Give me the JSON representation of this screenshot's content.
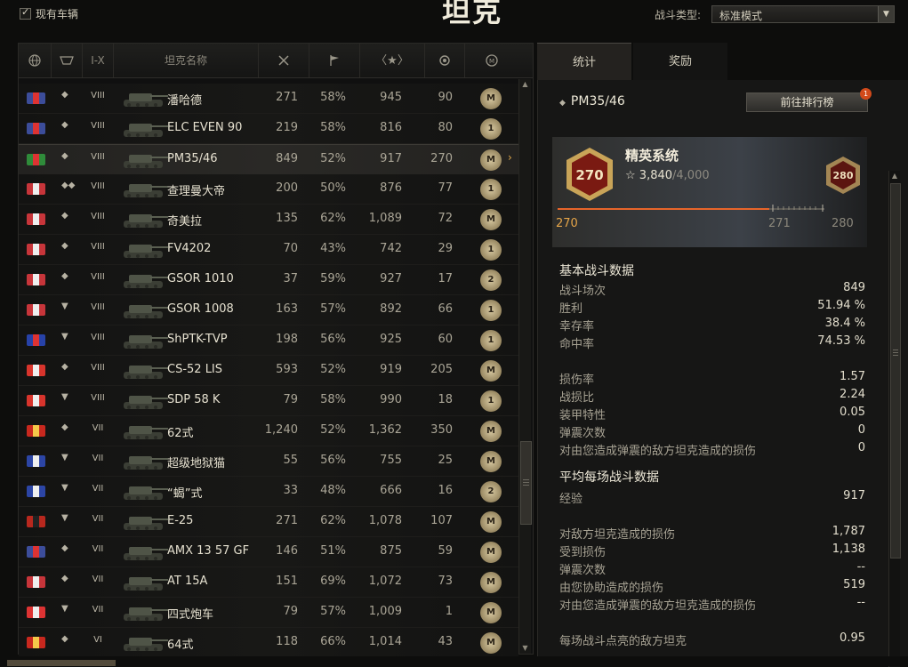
{
  "header": {
    "show_owned_label": "现有车辆",
    "title": "坦克",
    "battle_type_label": "战斗类型:",
    "battle_type_value": "标准模式"
  },
  "columns": {
    "tier": "I-X",
    "name": "坦克名称"
  },
  "tanks": [
    {
      "flag": "#3c4d9a",
      "flag2": "#d33",
      "type": "◆",
      "tier": "VIII",
      "name": "潘哈德",
      "battles": "271",
      "winrate": "58%",
      "xp": "945",
      "wn": "90",
      "badge": "M"
    },
    {
      "flag": "#3c4d9a",
      "flag2": "#d33",
      "type": "◆",
      "tier": "VIII",
      "name": "ELC EVEN 90",
      "battles": "219",
      "winrate": "58%",
      "xp": "816",
      "wn": "80",
      "badge": "1"
    },
    {
      "flag": "#2f8b3a",
      "flag2": "#d33",
      "type": "◆",
      "tier": "VIII",
      "name": "PM35/46",
      "battles": "849",
      "winrate": "52%",
      "xp": "917",
      "wn": "270",
      "badge": "M",
      "selected": true
    },
    {
      "flag": "#c7353a",
      "flag2": "#eee",
      "type": "◆◆",
      "tier": "VIII",
      "name": "查理曼大帝",
      "battles": "200",
      "winrate": "50%",
      "xp": "876",
      "wn": "77",
      "badge": "1"
    },
    {
      "flag": "#c7353a",
      "flag2": "#eee",
      "type": "◆",
      "tier": "VIII",
      "name": "奇美拉",
      "battles": "135",
      "winrate": "62%",
      "xp": "1,089",
      "wn": "72",
      "badge": "M"
    },
    {
      "flag": "#c7353a",
      "flag2": "#eee",
      "type": "◆",
      "tier": "VIII",
      "name": "FV4202",
      "battles": "70",
      "winrate": "43%",
      "xp": "742",
      "wn": "29",
      "badge": "1"
    },
    {
      "flag": "#c7353a",
      "flag2": "#eee",
      "type": "◆",
      "tier": "VIII",
      "name": "GSOR 1010",
      "battles": "37",
      "winrate": "59%",
      "xp": "927",
      "wn": "17",
      "badge": "2"
    },
    {
      "flag": "#c7353a",
      "flag2": "#eee",
      "type": "▼",
      "tier": "VIII",
      "name": "GSOR 1008",
      "battles": "163",
      "winrate": "57%",
      "xp": "892",
      "wn": "66",
      "badge": "1"
    },
    {
      "flag": "#2742a8",
      "flag2": "#d33",
      "type": "▼",
      "tier": "VIII",
      "name": "ShPTK-TVP",
      "battles": "198",
      "winrate": "56%",
      "xp": "925",
      "wn": "60",
      "badge": "1"
    },
    {
      "flag": "#d8342c",
      "flag2": "#eee",
      "type": "◆",
      "tier": "VIII",
      "name": "CS-52 LIS",
      "battles": "593",
      "winrate": "52%",
      "xp": "919",
      "wn": "205",
      "badge": "M"
    },
    {
      "flag": "#d8342c",
      "flag2": "#eee",
      "type": "▼",
      "tier": "VIII",
      "name": "SDP 58 K",
      "battles": "79",
      "winrate": "58%",
      "xp": "990",
      "wn": "18",
      "badge": "1"
    },
    {
      "flag": "#c8281e",
      "flag2": "#f5c84a",
      "type": "◆",
      "tier": "VII",
      "name": "62式",
      "battles": "1,240",
      "winrate": "52%",
      "xp": "1,362",
      "wn": "350",
      "badge": "M"
    },
    {
      "flag": "#2c45a5",
      "flag2": "#eee",
      "type": "▼",
      "tier": "VII",
      "name": "超级地狱猫",
      "battles": "55",
      "winrate": "56%",
      "xp": "755",
      "wn": "25",
      "badge": "M"
    },
    {
      "flag": "#2c45a5",
      "flag2": "#eee",
      "type": "▼",
      "tier": "VII",
      "name": "“蝎”式",
      "battles": "33",
      "winrate": "48%",
      "xp": "666",
      "wn": "16",
      "badge": "2"
    },
    {
      "flag": "#b8281e",
      "flag2": "#222",
      "type": "▼",
      "tier": "VII",
      "name": "E-25",
      "battles": "271",
      "winrate": "62%",
      "xp": "1,078",
      "wn": "107",
      "badge": "M"
    },
    {
      "flag": "#3c4d9a",
      "flag2": "#d33",
      "type": "◆",
      "tier": "VII",
      "name": "AMX 13 57 GF",
      "battles": "146",
      "winrate": "51%",
      "xp": "875",
      "wn": "59",
      "badge": "M"
    },
    {
      "flag": "#c7353a",
      "flag2": "#eee",
      "type": "◆",
      "tier": "VII",
      "name": "AT 15A",
      "battles": "151",
      "winrate": "69%",
      "xp": "1,072",
      "wn": "73",
      "badge": "M"
    },
    {
      "flag": "#d33",
      "flag2": "#eee",
      "type": "▼",
      "tier": "VII",
      "name": "四式炮车",
      "battles": "79",
      "winrate": "57%",
      "xp": "1,009",
      "wn": "1",
      "badge": "M"
    },
    {
      "flag": "#c8281e",
      "flag2": "#f5c84a",
      "type": "◆",
      "tier": "VI",
      "name": "64式",
      "battles": "118",
      "winrate": "66%",
      "xp": "1,014",
      "wn": "43",
      "badge": "M"
    }
  ],
  "right": {
    "tab_stats": "统计",
    "tab_awards": "奖励",
    "tank_name": "PM35/46",
    "rank_button": "前往排行榜",
    "notif_count": "1",
    "elite": {
      "level": "270",
      "title": "精英系统",
      "xp": "3,840",
      "xp_max": "/4,000",
      "next_badge": "280",
      "progress": 0.96,
      "label_left": "270",
      "label_mid": "271",
      "label_right": "280"
    },
    "basic_title": "基本战斗数据",
    "basic": [
      {
        "k": "战斗场次",
        "v": "849"
      },
      {
        "k": "胜利",
        "v": "51.94 %"
      },
      {
        "k": "幸存率",
        "v": "38.4 %"
      },
      {
        "k": "命中率",
        "v": "74.53 %"
      }
    ],
    "basic2": [
      {
        "k": "损伤率",
        "v": "1.57"
      },
      {
        "k": "战损比",
        "v": "2.24"
      },
      {
        "k": "装甲特性",
        "v": "0.05"
      },
      {
        "k": "弹震次数",
        "v": "0"
      },
      {
        "k": "对由您造成弹震的敌方坦克造成的损伤",
        "v": "0"
      }
    ],
    "avg_title": "平均每场战斗数据",
    "avg": [
      {
        "k": "经验",
        "v": "917"
      }
    ],
    "avg2": [
      {
        "k": "对敌方坦克造成的损伤",
        "v": "1,787"
      },
      {
        "k": "受到损伤",
        "v": "1,138"
      },
      {
        "k": "弹震次数",
        "v": "--"
      },
      {
        "k": "由您协助造成的损伤",
        "v": "519"
      },
      {
        "k": "对由您造成弹震的敌方坦克造成的损伤",
        "v": "--"
      }
    ],
    "last_row": {
      "k": "每场战斗点亮的敌方坦克",
      "v": "0.95"
    }
  }
}
